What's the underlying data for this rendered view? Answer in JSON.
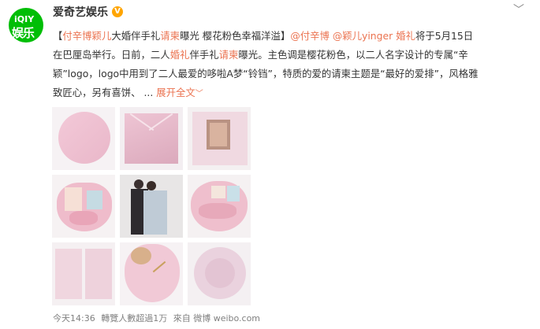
{
  "account": {
    "name": "爱奇艺娱乐",
    "avatar_line1": "iQIY",
    "avatar_line2": "娱乐",
    "verified_mark": "V"
  },
  "post": {
    "line1": {
      "bracket_open": "【",
      "hl1": "付辛博颖儿",
      "t1": "大婚伴手礼",
      "hl2": "请柬",
      "t2": "曝光 樱花粉色幸福洋溢】",
      "mention1": "@付辛博",
      "space": " ",
      "mention2": "@颖儿yinger",
      "t3": " ",
      "hl3": "婚礼",
      "t4": "将于5月15日"
    },
    "line2": {
      "t1": "在巴厘岛举行。日前，二人",
      "hl1": "婚礼",
      "t2": "伴手礼",
      "hl2": "请柬",
      "t3": "曝光。主色调是樱花粉色，以二人名字设计的专属“辛"
    },
    "line3": {
      "t1": "颖”logo，logo中用到了二人最爱的哆啦A梦“铃铛”，特质的爱的请柬主题是“最好的爱排”，风格雅"
    },
    "line4": {
      "t1": "致匠心，另有喜饼、 ... ",
      "more": "展开全文",
      "more_icon": "﹀"
    }
  },
  "footer": {
    "time": "今天14:36",
    "reads": "轉覽人數超過1万",
    "source": "來自 微博 weibo.com"
  },
  "icons": {
    "chevron": "﹀"
  },
  "photos": [
    "pink round card",
    "pink envelope",
    "photo card",
    "heart box with items",
    "couple photo",
    "heart box open",
    "pink folded cards",
    "heart box lid",
    "round sealed card"
  ]
}
